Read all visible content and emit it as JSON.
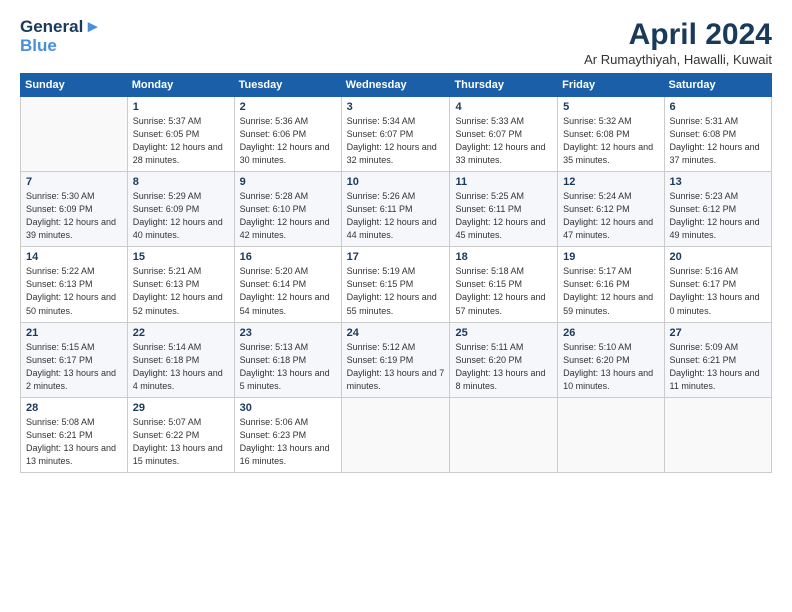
{
  "header": {
    "logo_line1": "General",
    "logo_line2": "Blue",
    "title": "April 2024",
    "location": "Ar Rumaythiyah, Hawalli, Kuwait"
  },
  "weekdays": [
    "Sunday",
    "Monday",
    "Tuesday",
    "Wednesday",
    "Thursday",
    "Friday",
    "Saturday"
  ],
  "weeks": [
    [
      {
        "day": "",
        "sunrise": "",
        "sunset": "",
        "daylight": ""
      },
      {
        "day": "1",
        "sunrise": "Sunrise: 5:37 AM",
        "sunset": "Sunset: 6:05 PM",
        "daylight": "Daylight: 12 hours and 28 minutes."
      },
      {
        "day": "2",
        "sunrise": "Sunrise: 5:36 AM",
        "sunset": "Sunset: 6:06 PM",
        "daylight": "Daylight: 12 hours and 30 minutes."
      },
      {
        "day": "3",
        "sunrise": "Sunrise: 5:34 AM",
        "sunset": "Sunset: 6:07 PM",
        "daylight": "Daylight: 12 hours and 32 minutes."
      },
      {
        "day": "4",
        "sunrise": "Sunrise: 5:33 AM",
        "sunset": "Sunset: 6:07 PM",
        "daylight": "Daylight: 12 hours and 33 minutes."
      },
      {
        "day": "5",
        "sunrise": "Sunrise: 5:32 AM",
        "sunset": "Sunset: 6:08 PM",
        "daylight": "Daylight: 12 hours and 35 minutes."
      },
      {
        "day": "6",
        "sunrise": "Sunrise: 5:31 AM",
        "sunset": "Sunset: 6:08 PM",
        "daylight": "Daylight: 12 hours and 37 minutes."
      }
    ],
    [
      {
        "day": "7",
        "sunrise": "Sunrise: 5:30 AM",
        "sunset": "Sunset: 6:09 PM",
        "daylight": "Daylight: 12 hours and 39 minutes."
      },
      {
        "day": "8",
        "sunrise": "Sunrise: 5:29 AM",
        "sunset": "Sunset: 6:09 PM",
        "daylight": "Daylight: 12 hours and 40 minutes."
      },
      {
        "day": "9",
        "sunrise": "Sunrise: 5:28 AM",
        "sunset": "Sunset: 6:10 PM",
        "daylight": "Daylight: 12 hours and 42 minutes."
      },
      {
        "day": "10",
        "sunrise": "Sunrise: 5:26 AM",
        "sunset": "Sunset: 6:11 PM",
        "daylight": "Daylight: 12 hours and 44 minutes."
      },
      {
        "day": "11",
        "sunrise": "Sunrise: 5:25 AM",
        "sunset": "Sunset: 6:11 PM",
        "daylight": "Daylight: 12 hours and 45 minutes."
      },
      {
        "day": "12",
        "sunrise": "Sunrise: 5:24 AM",
        "sunset": "Sunset: 6:12 PM",
        "daylight": "Daylight: 12 hours and 47 minutes."
      },
      {
        "day": "13",
        "sunrise": "Sunrise: 5:23 AM",
        "sunset": "Sunset: 6:12 PM",
        "daylight": "Daylight: 12 hours and 49 minutes."
      }
    ],
    [
      {
        "day": "14",
        "sunrise": "Sunrise: 5:22 AM",
        "sunset": "Sunset: 6:13 PM",
        "daylight": "Daylight: 12 hours and 50 minutes."
      },
      {
        "day": "15",
        "sunrise": "Sunrise: 5:21 AM",
        "sunset": "Sunset: 6:13 PM",
        "daylight": "Daylight: 12 hours and 52 minutes."
      },
      {
        "day": "16",
        "sunrise": "Sunrise: 5:20 AM",
        "sunset": "Sunset: 6:14 PM",
        "daylight": "Daylight: 12 hours and 54 minutes."
      },
      {
        "day": "17",
        "sunrise": "Sunrise: 5:19 AM",
        "sunset": "Sunset: 6:15 PM",
        "daylight": "Daylight: 12 hours and 55 minutes."
      },
      {
        "day": "18",
        "sunrise": "Sunrise: 5:18 AM",
        "sunset": "Sunset: 6:15 PM",
        "daylight": "Daylight: 12 hours and 57 minutes."
      },
      {
        "day": "19",
        "sunrise": "Sunrise: 5:17 AM",
        "sunset": "Sunset: 6:16 PM",
        "daylight": "Daylight: 12 hours and 59 minutes."
      },
      {
        "day": "20",
        "sunrise": "Sunrise: 5:16 AM",
        "sunset": "Sunset: 6:17 PM",
        "daylight": "Daylight: 13 hours and 0 minutes."
      }
    ],
    [
      {
        "day": "21",
        "sunrise": "Sunrise: 5:15 AM",
        "sunset": "Sunset: 6:17 PM",
        "daylight": "Daylight: 13 hours and 2 minutes."
      },
      {
        "day": "22",
        "sunrise": "Sunrise: 5:14 AM",
        "sunset": "Sunset: 6:18 PM",
        "daylight": "Daylight: 13 hours and 4 minutes."
      },
      {
        "day": "23",
        "sunrise": "Sunrise: 5:13 AM",
        "sunset": "Sunset: 6:18 PM",
        "daylight": "Daylight: 13 hours and 5 minutes."
      },
      {
        "day": "24",
        "sunrise": "Sunrise: 5:12 AM",
        "sunset": "Sunset: 6:19 PM",
        "daylight": "Daylight: 13 hours and 7 minutes."
      },
      {
        "day": "25",
        "sunrise": "Sunrise: 5:11 AM",
        "sunset": "Sunset: 6:20 PM",
        "daylight": "Daylight: 13 hours and 8 minutes."
      },
      {
        "day": "26",
        "sunrise": "Sunrise: 5:10 AM",
        "sunset": "Sunset: 6:20 PM",
        "daylight": "Daylight: 13 hours and 10 minutes."
      },
      {
        "day": "27",
        "sunrise": "Sunrise: 5:09 AM",
        "sunset": "Sunset: 6:21 PM",
        "daylight": "Daylight: 13 hours and 11 minutes."
      }
    ],
    [
      {
        "day": "28",
        "sunrise": "Sunrise: 5:08 AM",
        "sunset": "Sunset: 6:21 PM",
        "daylight": "Daylight: 13 hours and 13 minutes."
      },
      {
        "day": "29",
        "sunrise": "Sunrise: 5:07 AM",
        "sunset": "Sunset: 6:22 PM",
        "daylight": "Daylight: 13 hours and 15 minutes."
      },
      {
        "day": "30",
        "sunrise": "Sunrise: 5:06 AM",
        "sunset": "Sunset: 6:23 PM",
        "daylight": "Daylight: 13 hours and 16 minutes."
      },
      {
        "day": "",
        "sunrise": "",
        "sunset": "",
        "daylight": ""
      },
      {
        "day": "",
        "sunrise": "",
        "sunset": "",
        "daylight": ""
      },
      {
        "day": "",
        "sunrise": "",
        "sunset": "",
        "daylight": ""
      },
      {
        "day": "",
        "sunrise": "",
        "sunset": "",
        "daylight": ""
      }
    ]
  ]
}
